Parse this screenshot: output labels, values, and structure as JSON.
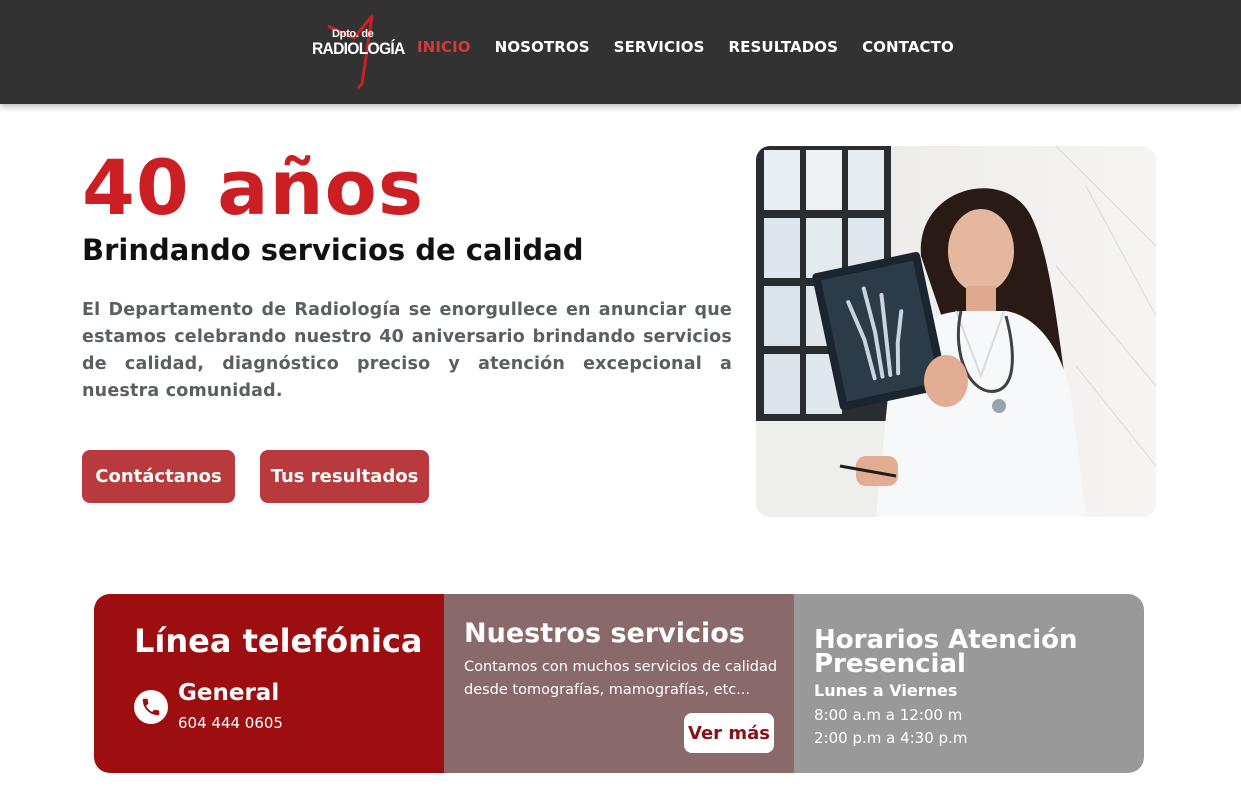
{
  "header": {
    "logo": {
      "line1": "Dpto. de",
      "line2": "RADIOLOGÍA",
      "accent": "#cc1f24"
    },
    "nav": [
      {
        "label": "INICIO",
        "active": true
      },
      {
        "label": "NOSOTROS",
        "active": false
      },
      {
        "label": "SERVICIOS",
        "active": false
      },
      {
        "label": "RESULTADOS",
        "active": false
      },
      {
        "label": "CONTACTO",
        "active": false
      }
    ]
  },
  "hero": {
    "title": "40 años",
    "subtitle": "Brindando servicios de calidad",
    "text": "El Departamento de Radiología se enorgullece en anunciar que estamos celebrando nuestro 40 aniversario brindando servicios de calidad, diagnóstico preciso y atención excepcional a nuestra comunidad.",
    "buttons": {
      "contact": "Contáctanos",
      "results": "Tus resultados"
    },
    "image": "doctor-holding-xray-photo"
  },
  "cards": {
    "phone": {
      "title": "Línea telefónica",
      "icon": "phone-icon",
      "label": "General",
      "number": "604 444 0605"
    },
    "services": {
      "title": "Nuestros servicios",
      "text": "Contamos con muchos servicios de calidad desde tomografías, mamografías, etc...",
      "button": "Ver más"
    },
    "hours": {
      "title": "Horarios Atención Presencial",
      "days": "Lunes a Viernes",
      "slot1": "8:00 a.m a 12:00 m",
      "slot2": "2:00 p.m a 4:30 p.m"
    }
  },
  "colors": {
    "header_bg": "#323232",
    "brand_red": "#cc1f24",
    "button_red": "#b83a3c",
    "card_red": "#9c0e10",
    "card_mauve": "#8a696a",
    "card_gray": "#999999"
  }
}
